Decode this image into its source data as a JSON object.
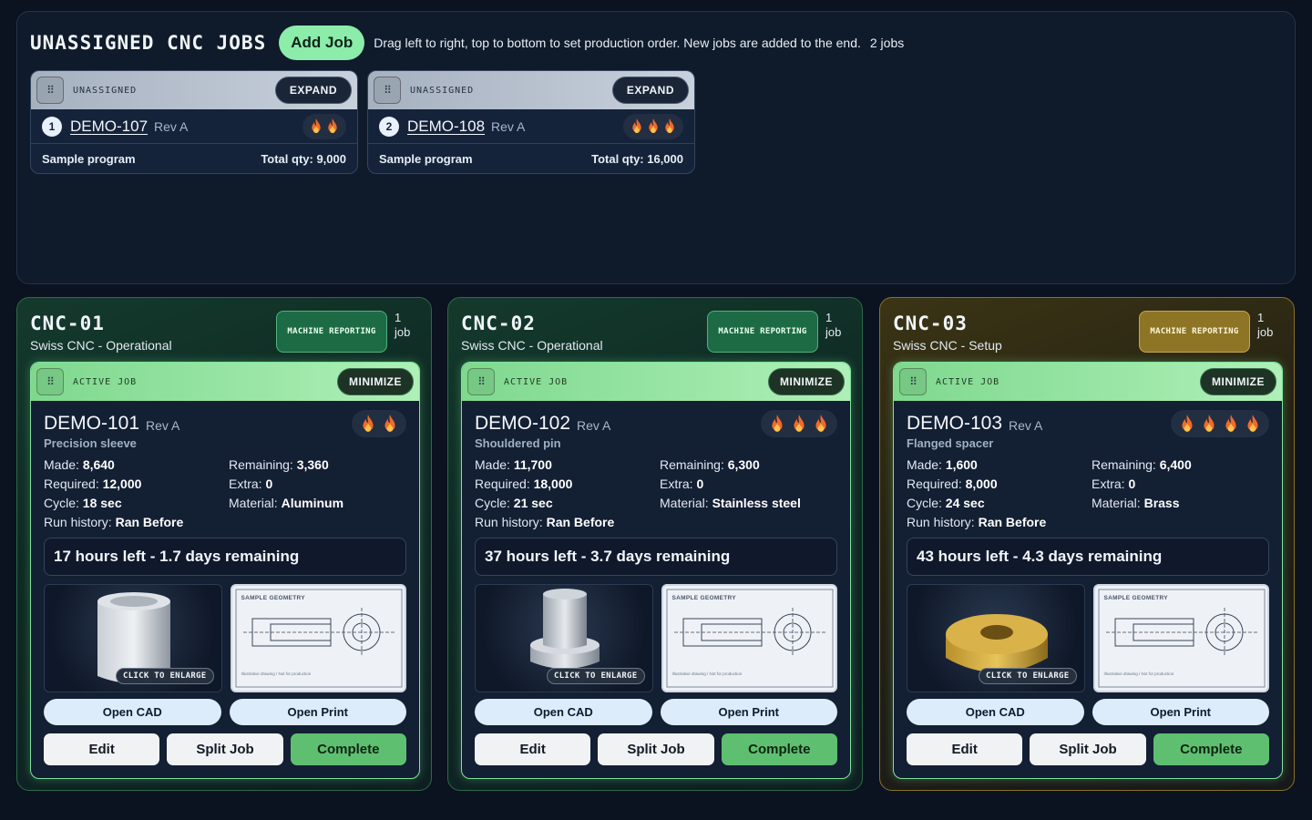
{
  "unassigned": {
    "title": "UNASSIGNED CNC JOBS",
    "add_label": "Add Job",
    "hint": "Drag left to right, top to bottom to set production order. New jobs are added to the end.",
    "count": "2 jobs",
    "cards": [
      {
        "bar_label": "UNASSIGNED",
        "expand": "EXPAND",
        "index": "1",
        "id": "DEMO-107",
        "rev": "Rev A",
        "flames": 2,
        "program": "Sample program",
        "total": "Total qty: 9,000"
      },
      {
        "bar_label": "UNASSIGNED",
        "expand": "EXPAND",
        "index": "2",
        "id": "DEMO-108",
        "rev": "Rev A",
        "flames": 3,
        "program": "Sample program",
        "total": "Total qty: 16,000"
      }
    ]
  },
  "machines": [
    {
      "name": "CNC-01",
      "subtitle": "Swiss CNC - Operational",
      "reporting": "MACHINE REPORTING",
      "count_num": "1",
      "count_unit": "job",
      "state": "operational",
      "job": {
        "bar_label": "ACTIVE JOB",
        "minimize": "MINIMIZE",
        "id": "DEMO-101",
        "rev": "Rev A",
        "flames": 2,
        "desc": "Precision sleeve",
        "made_label": "Made:",
        "made": "8,640",
        "remaining_label": "Remaining:",
        "remaining": "3,360",
        "required_label": "Required:",
        "required": "12,000",
        "extra_label": "Extra:",
        "extra": "0",
        "cycle_label": "Cycle:",
        "cycle": "18 sec",
        "material_label": "Material:",
        "material": "Aluminum",
        "history_label": "Run history:",
        "history": "Ran Before",
        "time": "17 hours left - 1.7 days remaining",
        "part": "sleeve",
        "enlarge": "CLICK TO ENLARGE",
        "print_title": "SAMPLE GEOMETRY",
        "print_note": "Illustrative drawing / Not for production",
        "open_cad": "Open CAD",
        "open_print": "Open Print",
        "edit": "Edit",
        "split": "Split Job",
        "complete": "Complete"
      }
    },
    {
      "name": "CNC-02",
      "subtitle": "Swiss CNC - Operational",
      "reporting": "MACHINE REPORTING",
      "count_num": "1",
      "count_unit": "job",
      "state": "operational",
      "job": {
        "bar_label": "ACTIVE JOB",
        "minimize": "MINIMIZE",
        "id": "DEMO-102",
        "rev": "Rev A",
        "flames": 3,
        "desc": "Shouldered pin",
        "made_label": "Made:",
        "made": "11,700",
        "remaining_label": "Remaining:",
        "remaining": "6,300",
        "required_label": "Required:",
        "required": "18,000",
        "extra_label": "Extra:",
        "extra": "0",
        "cycle_label": "Cycle:",
        "cycle": "21 sec",
        "material_label": "Material:",
        "material": "Stainless steel",
        "history_label": "Run history:",
        "history": "Ran Before",
        "time": "37 hours left - 3.7 days remaining",
        "part": "pin",
        "enlarge": "CLICK TO ENLARGE",
        "print_title": "SAMPLE GEOMETRY",
        "print_note": "Illustrative drawing / Not for production",
        "open_cad": "Open CAD",
        "open_print": "Open Print",
        "edit": "Edit",
        "split": "Split Job",
        "complete": "Complete"
      }
    },
    {
      "name": "CNC-03",
      "subtitle": "Swiss CNC - Setup",
      "reporting": "MACHINE REPORTING",
      "count_num": "1",
      "count_unit": "job",
      "state": "setup",
      "job": {
        "bar_label": "ACTIVE JOB",
        "minimize": "MINIMIZE",
        "id": "DEMO-103",
        "rev": "Rev A",
        "flames": 4,
        "desc": "Flanged spacer",
        "made_label": "Made:",
        "made": "1,600",
        "remaining_label": "Remaining:",
        "remaining": "6,400",
        "required_label": "Required:",
        "required": "8,000",
        "extra_label": "Extra:",
        "extra": "0",
        "cycle_label": "Cycle:",
        "cycle": "24 sec",
        "material_label": "Material:",
        "material": "Brass",
        "history_label": "Run history:",
        "history": "Ran Before",
        "time": "43 hours left - 4.3 days remaining",
        "part": "spacer",
        "enlarge": "CLICK TO ENLARGE",
        "print_title": "SAMPLE GEOMETRY",
        "print_note": "Illustrative drawing / Not for production",
        "open_cad": "Open CAD",
        "open_print": "Open Print",
        "edit": "Edit",
        "split": "Split Job",
        "complete": "Complete"
      }
    }
  ],
  "colors": {
    "accent_green": "#8cecaa",
    "active_bar": "#7fd88e",
    "setup_gold": "#8e7526",
    "flame": "#f06a2a"
  }
}
